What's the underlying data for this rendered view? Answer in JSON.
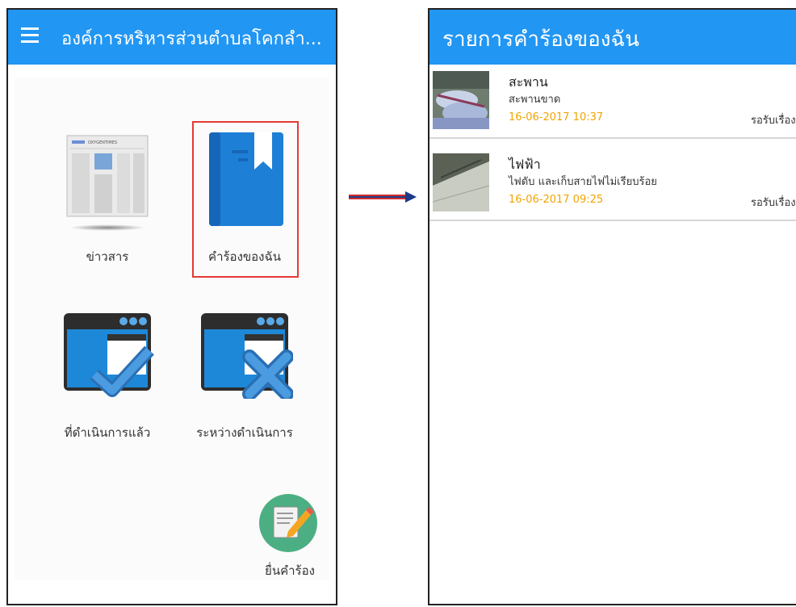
{
  "left_screen": {
    "title": "องค์การหริหารส่วนตำบลโคกลำ...",
    "tiles": [
      {
        "label": "ข่าวสาร",
        "icon": "newspaper-icon"
      },
      {
        "label": "คำร้องของฉัน",
        "icon": "book-icon",
        "selected": true
      },
      {
        "label": "ที่ดำเนินการแล้ว",
        "icon": "window-check-icon"
      },
      {
        "label": "ระหว่างดำเนินการ",
        "icon": "window-cross-icon"
      }
    ],
    "newspaper_masthead": "OXYGENTIMES",
    "fab_label": "ยื่นคำร้อง"
  },
  "right_screen": {
    "title": "รายการคำร้องของฉัน",
    "items": [
      {
        "title": "สะพาน",
        "subtitle": "สะพานขาด",
        "date": "16-06-2017 10:37",
        "status": "รอรับเรื่อง"
      },
      {
        "title": "ไฟฟ้า",
        "subtitle": "ไฟดับ และเก็บสายไฟไม่เรียบร้อย",
        "date": "16-06-2017 09:25",
        "status": "รอรับเรื่อง"
      }
    ]
  },
  "colors": {
    "appbar": "#2196F3",
    "selection": "#e53935",
    "arrow": "#d32f2f",
    "date": "#f2a400",
    "fab": "#4CAF83"
  }
}
